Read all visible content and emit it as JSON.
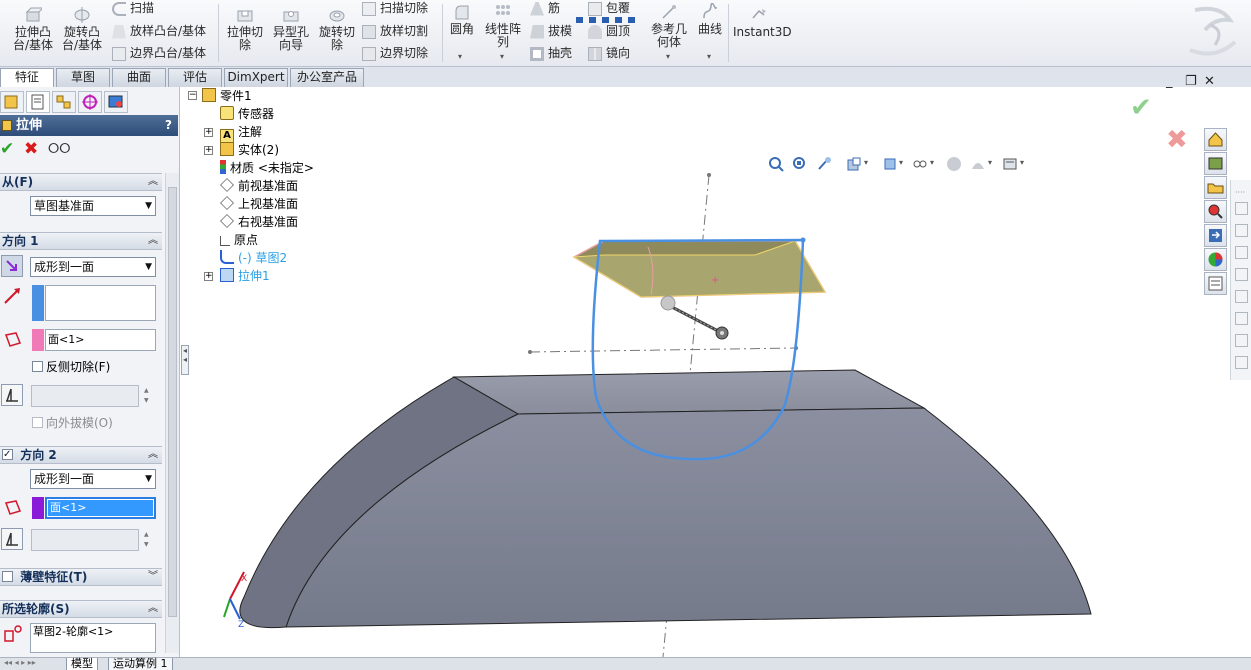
{
  "ribbon": {
    "extrude_boss": "拉伸凸\n台/基体",
    "revolve_boss": "旋转凸\n台/基体",
    "sweep": "扫描",
    "loft_boss": "放样凸台/基体",
    "boundary_boss": "边界凸台/基体",
    "extrude_cut": "拉伸切\n除",
    "hole_wizard": "异型孔\n向导",
    "revolve_cut": "旋转切\n除",
    "sweep_cut": "扫描切除",
    "loft_cut": "放样切割",
    "boundary_cut": "边界切除",
    "fillet": "圆角",
    "linear_pattern": "线性阵\n列",
    "rib": "筋",
    "draft": "拔模",
    "shell": "抽壳",
    "wrap": "包覆",
    "dome": "圆顶",
    "mirror": "镜向",
    "ref_geometry": "参考几\n何体",
    "curves": "曲线",
    "instant3d": "Instant3D"
  },
  "tabs": [
    "特征",
    "草图",
    "曲面",
    "评估",
    "DimXpert",
    "办公室产品"
  ],
  "property_manager": {
    "title": "拉伸",
    "help": "?",
    "from_label": "从(F)",
    "from_value": "草图基准面",
    "dir1_label": "方向 1",
    "dir1_end": "成形到一面",
    "dir1_face": "面<1>",
    "flip_side_cut": "反侧切除(F)",
    "draft_outward": "向外拔模(O)",
    "dir2_label": "方向 2",
    "dir2_end": "成形到一面",
    "dir2_face": "面<1>",
    "thin_feature": "薄壁特征(T)",
    "selected_contours": "所选轮廓(S)",
    "contour_item": "草图2-轮廓<1>"
  },
  "tree": {
    "part": "零件1",
    "sensors": "传感器",
    "annotations": "注解",
    "solid_bodies": "实体(2)",
    "material": "材质 <未指定>",
    "front_plane": "前视基准面",
    "top_plane": "上视基准面",
    "right_plane": "右视基准面",
    "origin": "原点",
    "sketch2": "(-) 草图2",
    "extrude1": "拉伸1"
  },
  "bottom_tabs": [
    "模型",
    "运动算例 1"
  ],
  "colors": {
    "accent_blue": "#4a90e2",
    "face_pink": "#f07ab8",
    "face_purple": "#8a1bd8",
    "selected_highlight": "#3399ff",
    "body_gray": "#8a8e9c"
  }
}
